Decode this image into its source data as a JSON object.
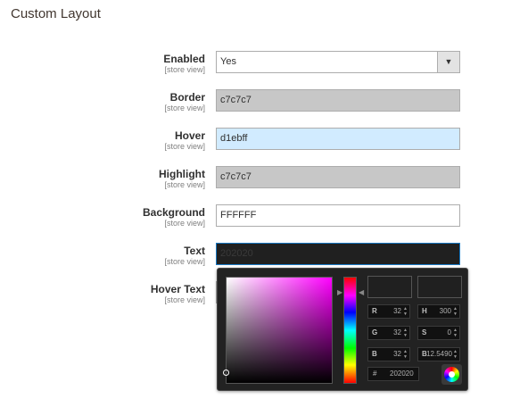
{
  "section": {
    "title": "Custom Layout"
  },
  "scope_label": "[store view]",
  "fields": {
    "enabled": {
      "label": "Enabled",
      "value": "Yes"
    },
    "border": {
      "label": "Border",
      "value": "c7c7c7"
    },
    "hover": {
      "label": "Hover",
      "value": "d1ebff"
    },
    "highlight": {
      "label": "Highlight",
      "value": "c7c7c7"
    },
    "background": {
      "label": "Background",
      "value": "FFFFFF"
    },
    "text": {
      "label": "Text",
      "value": "202020"
    },
    "hover_text": {
      "label": "Hover Text"
    }
  },
  "colors": {
    "border": "#c7c7c7",
    "hover": "#d1ebff",
    "highlight": "#c7c7c7",
    "background": "#FFFFFF",
    "text": "#202020"
  },
  "picker": {
    "r_label": "R",
    "r_value": "32",
    "g_label": "G",
    "g_value": "32",
    "b_label": "B",
    "b_value": "32",
    "h_label": "H",
    "h_value": "300",
    "s_label": "S",
    "s_value": "0",
    "bright_label": "B",
    "bright_value": "12.5490",
    "hex_label": "#",
    "hex_value": "202020",
    "submit_icon": "color-wheel-icon"
  }
}
